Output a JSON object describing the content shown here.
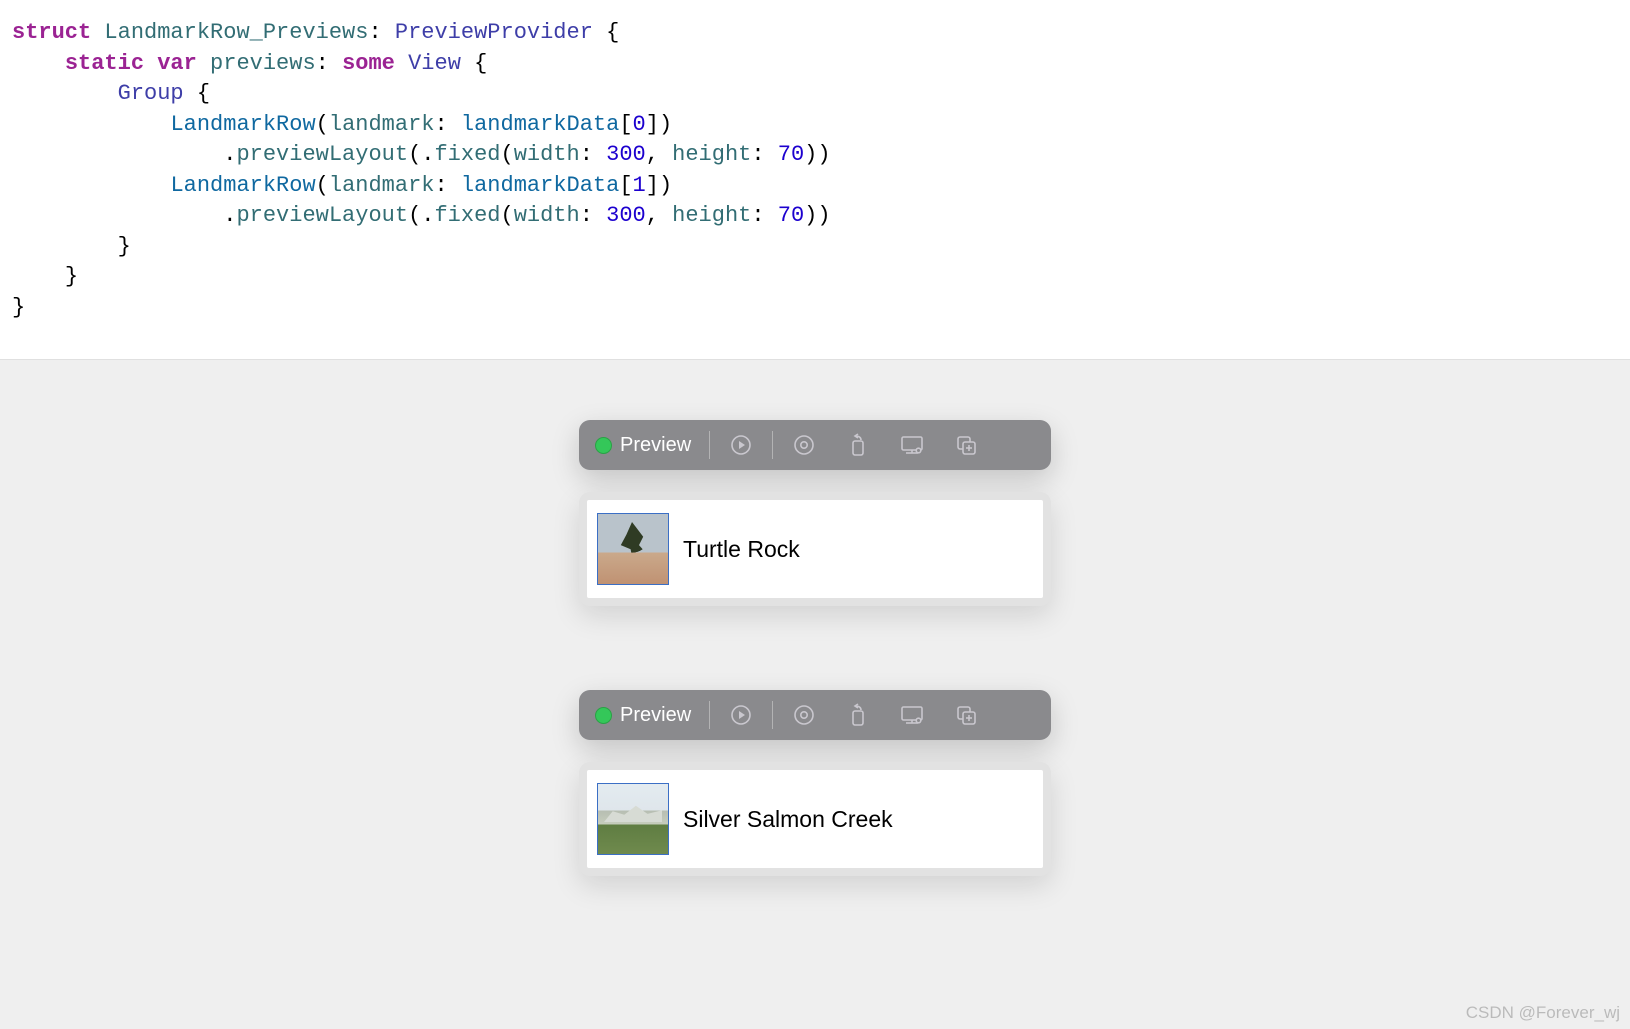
{
  "code": {
    "line1": {
      "kw_struct": "struct",
      "name": "LandmarkRow_Previews",
      "type": "PreviewProvider",
      "brace": "{"
    },
    "line2": {
      "kw_static": "static",
      "kw_var": "var",
      "name": "previews",
      "kw_some": "some",
      "type": "View",
      "brace": "{"
    },
    "line3": {
      "type": "Group",
      "brace": "{"
    },
    "line4": {
      "id": "LandmarkRow",
      "open": "(",
      "param": "landmark",
      "colon": ": ",
      "data": "landmarkData",
      "idx_open": "[",
      "idx": "0",
      "idx_close": "])"
    },
    "line5": {
      "dot": ".",
      "func": "previewLayout",
      "open": "(.",
      "fixed": "fixed",
      "open2": "(",
      "w": "width",
      "colon1": ": ",
      "wval": "300",
      "comma": ", ",
      "h": "height",
      "colon2": ": ",
      "hval": "70",
      "close": "))"
    },
    "line6": {
      "id": "LandmarkRow",
      "open": "(",
      "param": "landmark",
      "colon": ": ",
      "data": "landmarkData",
      "idx_open": "[",
      "idx": "1",
      "idx_close": "])"
    },
    "line7": {
      "dot": ".",
      "func": "previewLayout",
      "open": "(.",
      "fixed": "fixed",
      "open2": "(",
      "w": "width",
      "colon1": ": ",
      "wval": "300",
      "comma": ", ",
      "h": "height",
      "colon2": ": ",
      "hval": "70",
      "close": "))"
    },
    "line8": {
      "brace": "}"
    },
    "line9": {
      "brace": "}"
    },
    "line10": {
      "brace": "}"
    }
  },
  "previews": [
    {
      "toolbar_label": "Preview",
      "row_title": "Turtle Rock",
      "thumb_class": "rock"
    },
    {
      "toolbar_label": "Preview",
      "row_title": "Silver Salmon Creek",
      "thumb_class": "creek"
    }
  ],
  "watermark": "CSDN @Forever_wj"
}
